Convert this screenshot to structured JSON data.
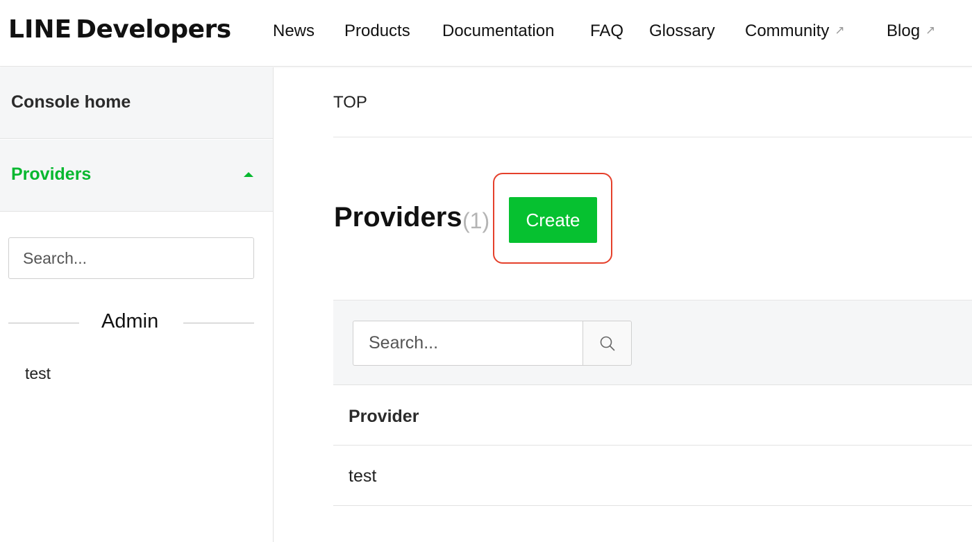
{
  "header": {
    "brand": "LINE",
    "brand_suffix": "Developers",
    "nav": [
      {
        "label": "News"
      },
      {
        "label": "Products"
      },
      {
        "label": "Documentation"
      },
      {
        "label": "FAQ"
      },
      {
        "label": "Glossary"
      },
      {
        "label": "Community",
        "external": true
      },
      {
        "label": "Blog",
        "external": true
      }
    ],
    "external_icon": "external-link-icon"
  },
  "sidebar": {
    "home_label": "Console home",
    "providers_label": "Providers",
    "search_placeholder": "Search...",
    "section_label": "Admin",
    "items": [
      {
        "label": "test"
      }
    ]
  },
  "main": {
    "breadcrumb": "TOP",
    "title": "Providers",
    "count": "(1)",
    "create_label": "Create",
    "search_placeholder": "Search...",
    "table": {
      "columns": [
        "Provider"
      ],
      "rows": [
        [
          "test"
        ]
      ]
    }
  },
  "colors": {
    "accent_green": "#06c130",
    "highlight_red": "#e5402b"
  }
}
